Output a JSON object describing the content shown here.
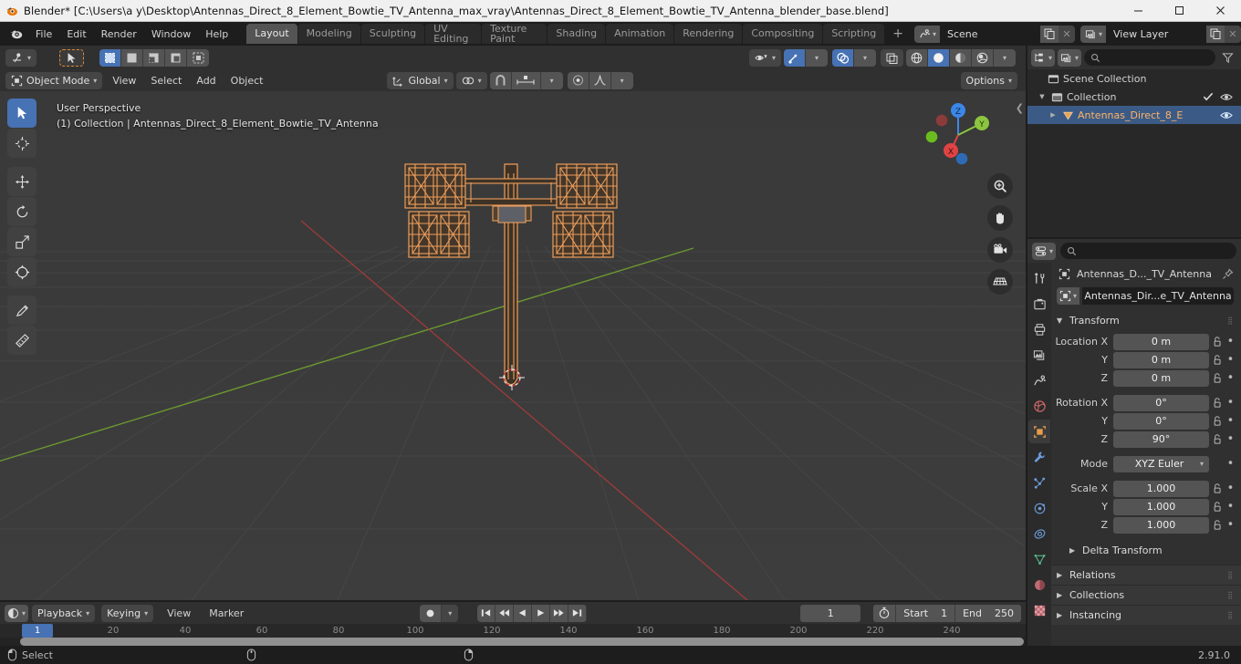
{
  "window": {
    "title": "Blender* [C:\\Users\\a y\\Desktop\\Antennas_Direct_8_Element_Bowtie_TV_Antenna_max_vray\\Antennas_Direct_8_Element_Bowtie_TV_Antenna_blender_base.blend]",
    "minimize": "—",
    "maximize": "□",
    "close": "✕"
  },
  "topbar": {
    "menus": [
      "File",
      "Edit",
      "Render",
      "Window",
      "Help"
    ],
    "workspaces": [
      {
        "label": "Layout",
        "active": true
      },
      {
        "label": "Modeling",
        "active": false
      },
      {
        "label": "Sculpting",
        "active": false
      },
      {
        "label": "UV Editing",
        "active": false
      },
      {
        "label": "Texture Paint",
        "active": false
      },
      {
        "label": "Shading",
        "active": false
      },
      {
        "label": "Animation",
        "active": false
      },
      {
        "label": "Rendering",
        "active": false
      },
      {
        "label": "Compositing",
        "active": false
      },
      {
        "label": "Scripting",
        "active": false
      }
    ],
    "add_workspace": "+",
    "scene": {
      "name": "Scene",
      "icon": "scene-icon"
    },
    "view_layer": {
      "name": "View Layer",
      "icon": "view-layer-icon"
    }
  },
  "viewport": {
    "editor_type_icon": "editor-type-3dview-icon",
    "select_tool_icon": "tweak-cursor-icon",
    "select_modes": [
      "set-new",
      "extend",
      "subtract",
      "invert",
      "intersect"
    ],
    "mode": "Object Mode",
    "menus": [
      "View",
      "Select",
      "Add",
      "Object"
    ],
    "transform_orientation": "Global",
    "pivot_icon": "pivot-point-icon",
    "snap_icon": "snap-magnet-icon",
    "proportional_icon": "proportional-editing-icon",
    "options_label": "Options",
    "overlay_text_line1": "User Perspective",
    "overlay_text_line2": "(1) Collection | Antennas_Direct_8_Element_Bowtie_TV_Antenna",
    "gizmo_axes": [
      "Z",
      "Y",
      "X"
    ],
    "shading_modes": [
      "wireframe",
      "solid",
      "material-preview",
      "rendered"
    ],
    "active_shading_mode": "solid",
    "tools": [
      "tweak-tool",
      "cursor-tool",
      "move-tool",
      "rotate-tool",
      "scale-tool",
      "transform-tool",
      "annotate-tool",
      "measure-tool"
    ],
    "nav_buttons": [
      "zoom-icon",
      "hand-icon",
      "camera-icon",
      "grid-ortho-icon"
    ]
  },
  "outliner": {
    "display_mode_icon": "outliner-view-layer-icon",
    "filter_icon": "filter-icon",
    "search_placeholder": "",
    "rows": [
      {
        "label": "Scene Collection",
        "indent": 0,
        "icon": "collection-icon",
        "tri": "",
        "selected": false,
        "checkbox": false,
        "eye": false
      },
      {
        "label": "Collection",
        "indent": 1,
        "icon": "collection-icon",
        "tri": "▼",
        "selected": false,
        "checkbox": true,
        "eye": true
      },
      {
        "label": "Antennas_Direct_8_E",
        "indent": 2,
        "icon": "mesh-object-icon",
        "tri": "▶",
        "selected": true,
        "checkbox": false,
        "eye": true
      }
    ]
  },
  "properties": {
    "editor_icon": "properties-editor-icon",
    "search_placeholder": "",
    "breadcrumb": "Antennas_D..._TV_Antenna",
    "object_name": "Antennas_Dir...e_TV_Antenna",
    "tabs": [
      "tool-icon",
      "render-icon",
      "output-icon",
      "view-layer-icon",
      "scene-icon",
      "world-icon",
      "object-icon",
      "modifiers-icon",
      "particles-icon",
      "physics-icon",
      "constraints-icon",
      "data-icon",
      "material-icon",
      "texture-icon"
    ],
    "active_tab": "object-icon",
    "transform_panel": {
      "title": "Transform",
      "rows": [
        {
          "label": "Location X",
          "value": "0 m"
        },
        {
          "label": "Y",
          "value": "0 m"
        },
        {
          "label": "Z",
          "value": "0 m"
        },
        {
          "label": "Rotation X",
          "value": "0°"
        },
        {
          "label": "Y",
          "value": "0°"
        },
        {
          "label": "Z",
          "value": "90°"
        }
      ],
      "mode_label": "Mode",
      "mode_value": "XYZ Euler",
      "scale_rows": [
        {
          "label": "Scale X",
          "value": "1.000"
        },
        {
          "label": "Y",
          "value": "1.000"
        },
        {
          "label": "Z",
          "value": "1.000"
        }
      ],
      "delta_transform": "Delta Transform"
    },
    "collapsed_panels": [
      "Relations",
      "Collections",
      "Instancing"
    ]
  },
  "timeline": {
    "editor_icon": "timeline-editor-icon",
    "playback": "Playback",
    "keying": "Keying",
    "menus": [
      "View",
      "Marker"
    ],
    "record_icon": "record-icon",
    "transport": [
      "jump-start-icon",
      "prev-keyframe-icon",
      "play-reverse-icon",
      "play-icon",
      "next-keyframe-icon",
      "jump-end-icon"
    ],
    "current_frame": "1",
    "timer_icon": "auto-key-icon",
    "start_label": "Start",
    "start_value": "1",
    "end_label": "End",
    "end_value": "250",
    "ticks": [
      "20",
      "40",
      "60",
      "80",
      "100",
      "120",
      "140",
      "160",
      "180",
      "200",
      "220",
      "240"
    ],
    "playhead_frame": "1"
  },
  "statusbar": {
    "mouse_left_label": "Select",
    "version": "2.91.0"
  },
  "colors": {
    "accent_blue": "#4772b3",
    "selected_orange": "#ed9e5c",
    "axis_x": "#e04343",
    "axis_y": "#8cc63f",
    "axis_z": "#3b87e8",
    "panel_bg": "#303030",
    "viewport_bg": "#3b3b3b"
  }
}
